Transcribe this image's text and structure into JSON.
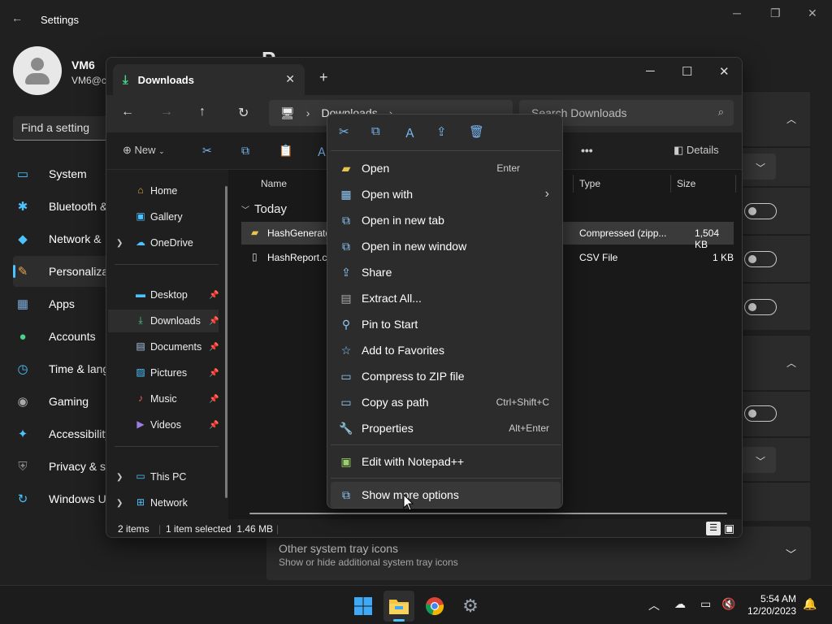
{
  "settings": {
    "title": "Settings",
    "user_name": "VM6",
    "user_email": "VM6@c",
    "page_title_partial": "P",
    "find_placeholder": "Find a setting",
    "nav": [
      {
        "label": "System",
        "icon": "system-icon"
      },
      {
        "label": "Bluetooth &",
        "icon": "bluetooth-icon"
      },
      {
        "label": "Network &",
        "icon": "network-icon"
      },
      {
        "label": "Personaliza",
        "icon": "brush-icon",
        "selected": true
      },
      {
        "label": "Apps",
        "icon": "apps-icon"
      },
      {
        "label": "Accounts",
        "icon": "accounts-icon"
      },
      {
        "label": "Time & lang",
        "icon": "time-icon"
      },
      {
        "label": "Gaming",
        "icon": "gaming-icon"
      },
      {
        "label": "Accessibility",
        "icon": "accessibility-icon"
      },
      {
        "label": "Privacy & se",
        "icon": "privacy-icon"
      },
      {
        "label": "Windows U",
        "icon": "update-icon"
      }
    ],
    "tray_row": {
      "title": "Other system tray icons",
      "subtitle": "Show or hide additional system tray icons"
    }
  },
  "explorer": {
    "tab_title": "Downloads",
    "breadcrumb": [
      "Downloads"
    ],
    "search_placeholder": "Search Downloads",
    "new_label": "New",
    "details_label": "Details",
    "more_label": "•••",
    "sidebar": [
      {
        "label": "Home",
        "icon": "home-icon",
        "expand": false
      },
      {
        "label": "Gallery",
        "icon": "gallery-icon",
        "expand": false
      },
      {
        "label": "OneDrive",
        "icon": "onedrive-icon",
        "expand": true
      },
      {
        "label": "Desktop",
        "icon": "desktop-icon",
        "pinned": true
      },
      {
        "label": "Downloads",
        "icon": "downloads-icon",
        "pinned": true,
        "selected": true
      },
      {
        "label": "Documents",
        "icon": "documents-icon",
        "pinned": true
      },
      {
        "label": "Pictures",
        "icon": "pictures-icon",
        "pinned": true
      },
      {
        "label": "Music",
        "icon": "music-icon",
        "pinned": true
      },
      {
        "label": "Videos",
        "icon": "videos-icon",
        "pinned": true
      },
      {
        "label": "This PC",
        "icon": "this-pc-icon",
        "expand": true
      },
      {
        "label": "Network",
        "icon": "network-icon",
        "expand": true
      }
    ],
    "columns": {
      "name": "Name",
      "type": "Type",
      "size": "Size"
    },
    "group": "Today",
    "files": [
      {
        "name": "HashGenerato",
        "type": "Compressed (zipp...",
        "size": "1,504 KB",
        "selected": true
      },
      {
        "name": "HashReport.cs",
        "type": "CSV File",
        "size": "1 KB",
        "selected": false
      }
    ],
    "status": {
      "count": "2 items",
      "selected": "1 item selected  1.46 MB"
    }
  },
  "context_menu": {
    "quick_actions": [
      "cut-icon",
      "copy-icon",
      "rename-icon",
      "share-icon",
      "delete-icon"
    ],
    "items": [
      {
        "label": "Open",
        "shortcut": "Enter",
        "icon": "folder-open-icon"
      },
      {
        "label": "Open with",
        "shortcut": "›",
        "icon": "open-with-icon"
      },
      {
        "label": "Open in new tab",
        "shortcut": "",
        "icon": "new-tab-icon"
      },
      {
        "label": "Open in new window",
        "shortcut": "",
        "icon": "new-window-icon"
      },
      {
        "label": "Share",
        "shortcut": "",
        "icon": "share-icon"
      },
      {
        "label": "Extract All...",
        "shortcut": "",
        "icon": "extract-icon"
      },
      {
        "label": "Pin to Start",
        "shortcut": "",
        "icon": "pin-icon"
      },
      {
        "label": "Add to Favorites",
        "shortcut": "",
        "icon": "star-icon"
      },
      {
        "label": "Compress to ZIP file",
        "shortcut": "",
        "icon": "zip-icon"
      },
      {
        "label": "Copy as path",
        "shortcut": "Ctrl+Shift+C",
        "icon": "copy-path-icon"
      },
      {
        "label": "Properties",
        "shortcut": "Alt+Enter",
        "icon": "wrench-icon"
      },
      {
        "label": "Edit with Notepad++",
        "shortcut": "",
        "icon": "notepadpp-icon"
      },
      {
        "label": "Show more options",
        "shortcut": "",
        "icon": "more-options-icon"
      }
    ]
  },
  "taskbar": {
    "time": "5:54 AM",
    "date": "12/20/2023"
  }
}
